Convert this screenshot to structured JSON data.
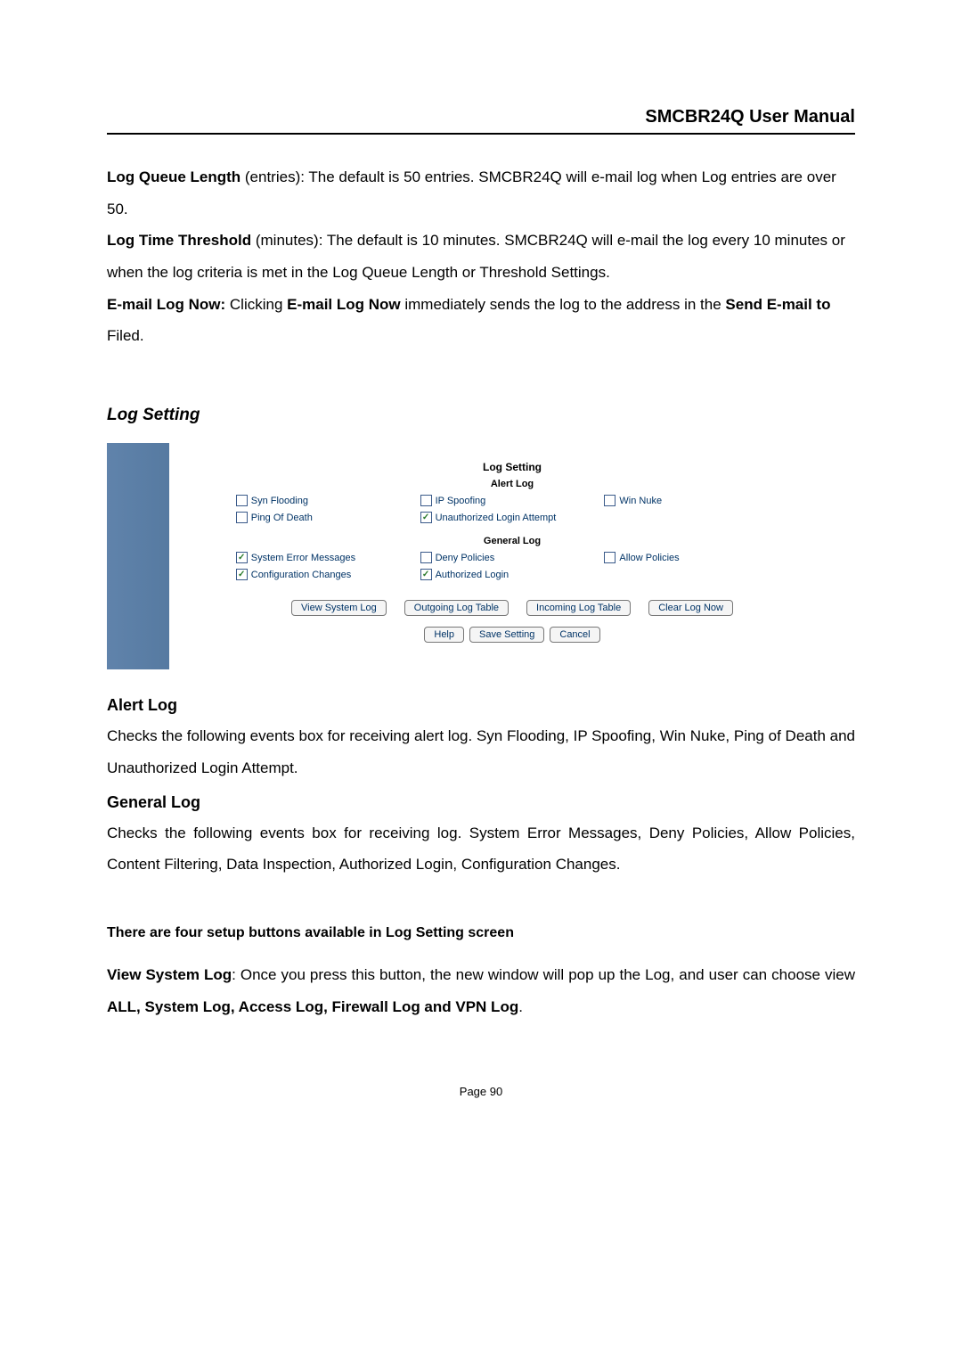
{
  "header": {
    "title": "SMCBR24Q User Manual"
  },
  "intro": {
    "p1a": "Log Queue Length",
    "p1b": " (entries): The default is 50 entries. SMCBR24Q will e-mail log when Log entries are over 50.",
    "p2a": "Log Time Threshold",
    "p2b": " (minutes): The default is 10 minutes. SMCBR24Q will e-mail the log every 10 minutes or when the log criteria is met in the Log Queue Length or Threshold Settings.",
    "p3a": "E-mail Log Now:",
    "p3b": " Clicking ",
    "p3c": "E-mail Log Now",
    "p3d": " immediately sends the log to the address in the ",
    "p3e": "Send E-mail to",
    "p3f": " Filed."
  },
  "section2_title": "Log Setting",
  "screenshot": {
    "title": "Log Setting",
    "alert_title": "Alert Log",
    "general_title": "General Log",
    "alert": {
      "syn": "Syn Flooding",
      "ip": "IP Spoofing",
      "win": "Win Nuke",
      "ping": "Ping Of Death",
      "unauth": "Unauthorized Login Attempt"
    },
    "general": {
      "syserr": "System Error Messages",
      "deny": "Deny Policies",
      "allow": "Allow Policies",
      "config": "Configuration Changes",
      "auth": "Authorized Login"
    },
    "buttons": {
      "view": "View System Log",
      "outgoing": "Outgoing Log Table",
      "incoming": "Incoming Log Table",
      "clear": "Clear Log Now",
      "help": "Help",
      "save": "Save Setting",
      "cancel": "Cancel"
    }
  },
  "alert_h": "Alert Log",
  "alert_p": "Checks the following events box for receiving alert log. Syn Flooding, IP Spoofing, Win Nuke, Ping of Death and Unauthorized Login Attempt.",
  "general_h": "General Log",
  "general_p": "Checks the following events box for receiving log. System Error Messages, Deny Policies, Allow Policies, Content Filtering, Data Inspection, Authorized Login, Configuration Changes.",
  "setup_h": "There are four setup buttons available in Log Setting screen",
  "view_p1a": "View System Log",
  "view_p1b": ": Once you press this button, the new window will pop up the Log, and user can choose view ",
  "view_p1c": "ALL, System Log, Access Log, Firewall Log and VPN Log",
  "view_p1d": ".",
  "footer": "Page 90"
}
